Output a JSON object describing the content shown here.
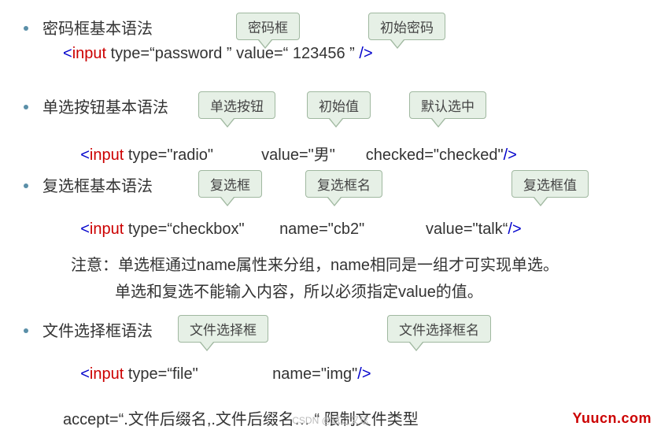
{
  "sec1": {
    "title": "密码框基本语法",
    "callouts": {
      "c1": "密码框",
      "c2": "初始密码"
    },
    "code": {
      "open": "<",
      "tag": "input",
      "attr1": " type=",
      "val1": "“password ”",
      "attr2": "  value=",
      "val2": "“ 123456 ”",
      "close": " />"
    }
  },
  "sec2": {
    "title": "单选按钮基本语法",
    "callouts": {
      "c1": "单选按钮",
      "c2": "初始值",
      "c3": "默认选中"
    },
    "code": {
      "open": "<",
      "tag": "input",
      "attr1": " type=",
      "val1": "\"radio\"",
      "attr2": "           value=",
      "val2": "\"男\"",
      "attr3": "       checked=",
      "val3": "\"checked\"",
      "close": "/>"
    }
  },
  "sec3": {
    "title": "复选框基本语法",
    "callouts": {
      "c1": "复选框",
      "c2": "复选框名",
      "c3": "复选框值"
    },
    "code": {
      "open": "<",
      "tag": "input",
      "attr1": " type=",
      "val1": "“checkbox\"",
      "attr2": "        name=",
      "val2": "\"cb2\"",
      "attr3": "              value=",
      "val3": "\"talk“",
      "close": "/>"
    }
  },
  "note": {
    "line1": "注意：单选框通过name属性来分组，name相同是一组才可实现单选。",
    "line2": "单选和复选不能输入内容，所以必须指定value的值。"
  },
  "sec4": {
    "title": "文件选择框语法",
    "callouts": {
      "c1": "文件选择框",
      "c2": "文件选择框名"
    },
    "code": {
      "open": "<",
      "tag": "input",
      "attr1": " type=",
      "val1": "“file\"",
      "attr2": "                 name=",
      "val2": "\"img\"",
      "close": "/>"
    },
    "extra": "accept=“.文件后缀名,.文件后缀名… “   限制文件类型"
  },
  "wm1": "Yuucn.com",
  "wm2": "CSDN @玹之又玹"
}
